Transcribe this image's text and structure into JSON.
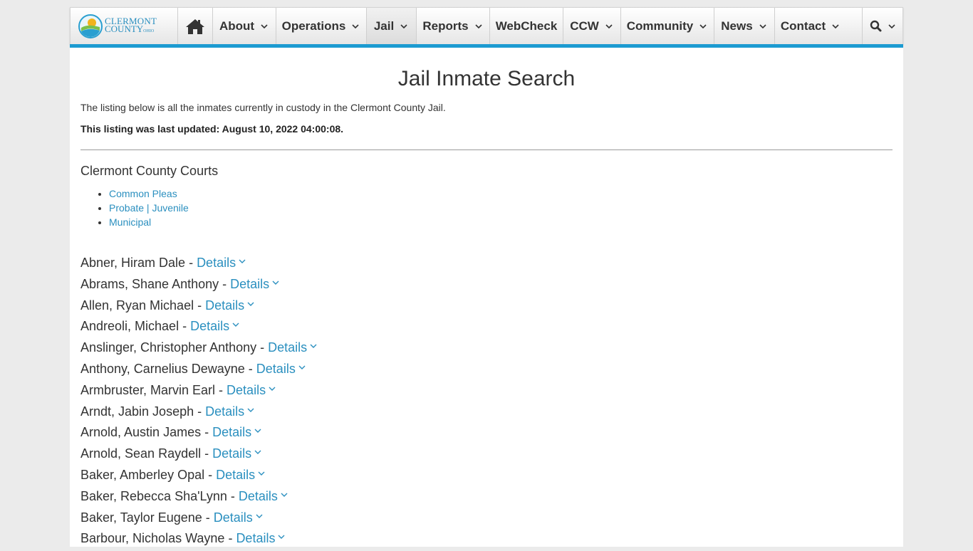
{
  "brand": {
    "line1": "CLERMONT",
    "line2": "COUNTY",
    "line2_small": "OHIO"
  },
  "nav": {
    "home_icon": "home-icon",
    "items": [
      {
        "label": "About",
        "caret": true
      },
      {
        "label": "Operations",
        "caret": true
      },
      {
        "label": "Jail",
        "caret": true,
        "active": true
      },
      {
        "label": "Reports",
        "caret": true
      },
      {
        "label": "WebCheck",
        "caret": false
      },
      {
        "label": "CCW",
        "caret": true
      },
      {
        "label": "Community",
        "caret": true
      },
      {
        "label": "News",
        "caret": true
      },
      {
        "label": "Contact",
        "caret": true
      }
    ],
    "search_icon": "search-icon"
  },
  "colors": {
    "accent": "#1c9bd1",
    "link": "#2a8fbf",
    "background": "#ebebeb"
  },
  "page": {
    "title": "Jail Inmate Search",
    "intro": "The listing below is all the inmates currently in custody in the Clermont County Jail.",
    "updated": "This listing was last updated: August 10, 2022 04:00:08."
  },
  "courts": {
    "title": "Clermont County Courts",
    "links": [
      "Common Pleas",
      "Probate | Juvenile",
      "Municipal"
    ]
  },
  "inmates": {
    "separator": " - ",
    "details_label": "Details",
    "list": [
      "Abner, Hiram Dale",
      "Abrams, Shane Anthony",
      "Allen, Ryan Michael",
      "Andreoli, Michael",
      "Anslinger, Christopher Anthony",
      "Anthony, Carnelius Dewayne",
      "Armbruster, Marvin Earl",
      "Arndt, Jabin Joseph",
      "Arnold, Austin James",
      "Arnold, Sean Raydell",
      "Baker, Amberley Opal",
      "Baker, Rebecca Sha'Lynn",
      "Baker, Taylor Eugene",
      "Barbour, Nicholas Wayne"
    ]
  }
}
